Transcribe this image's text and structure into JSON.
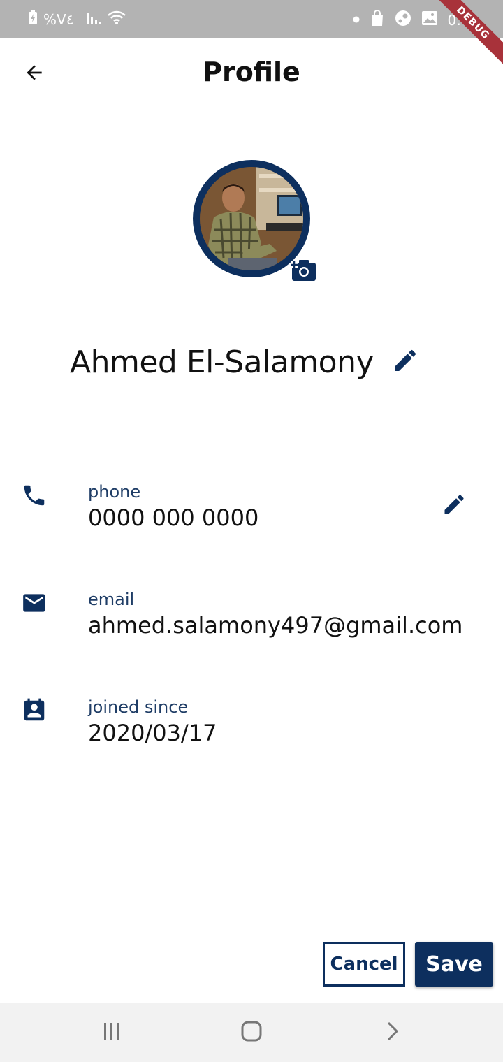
{
  "status_bar": {
    "battery_text": "%V٤",
    "icons": [
      "battery-charging-icon",
      "signal-icon",
      "wifi-icon",
      "dot-icon",
      "shopping-bag-icon",
      "steam-icon",
      "image-icon"
    ],
    "debug_label": "DEBUG"
  },
  "app_bar": {
    "title": "Profile",
    "back_icon": "arrow-left-icon"
  },
  "profile": {
    "name": "Ahmed El-Salamony",
    "avatar_icon": "user-photo",
    "camera_icon": "add-photo-icon",
    "edit_icon": "pencil-icon"
  },
  "info": {
    "phone": {
      "label": "phone",
      "value": "0000 000 0000",
      "icon": "phone-icon"
    },
    "email": {
      "label": "email",
      "value": "ahmed.salamony497@gmail.com",
      "icon": "mail-icon"
    },
    "joined": {
      "label": "joined since",
      "value": "2020/03/17",
      "icon": "contact-calendar-icon"
    }
  },
  "actions": {
    "cancel_label": "Cancel",
    "save_label": "Save"
  },
  "nav": {
    "recents_icon": "recents-icon",
    "home_icon": "home-icon",
    "back_icon": "chevron-right-icon"
  },
  "colors": {
    "primary": "#0d2f5e",
    "label": "#1f3d66",
    "status_bar": "#b3b3b3",
    "debug_ribbon": "#a8323a",
    "nav_bar": "#f2f2f2"
  }
}
